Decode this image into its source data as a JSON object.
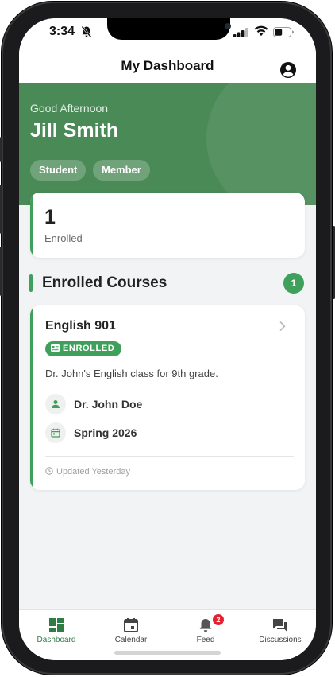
{
  "status_bar": {
    "time": "3:34"
  },
  "header": {
    "title": "My Dashboard"
  },
  "hero": {
    "greeting": "Good Afternoon",
    "name": "Jill Smith",
    "tags": [
      "Student",
      "Member"
    ]
  },
  "stats": {
    "enrolled_count": "1",
    "enrolled_label": "Enrolled"
  },
  "section": {
    "title": "Enrolled Courses",
    "count": "1"
  },
  "course": {
    "title": "English 901",
    "status": "ENROLLED",
    "description": "Dr. John's English class for 9th grade.",
    "instructor": "Dr. John Doe",
    "term": "Spring 2026",
    "updated": "Updated Yesterday"
  },
  "tabbar": {
    "tabs": [
      {
        "label": "Dashboard",
        "icon": "dashboard-icon",
        "active": true
      },
      {
        "label": "Calendar",
        "icon": "calendar-icon",
        "active": false
      },
      {
        "label": "Feed",
        "icon": "bell-icon",
        "active": false,
        "badge": "2"
      },
      {
        "label": "Discussions",
        "icon": "forum-icon",
        "active": false
      }
    ]
  },
  "colors": {
    "brand_green": "#4a8a57",
    "accent_green": "#3ea05a",
    "badge_red": "#e5202f"
  }
}
